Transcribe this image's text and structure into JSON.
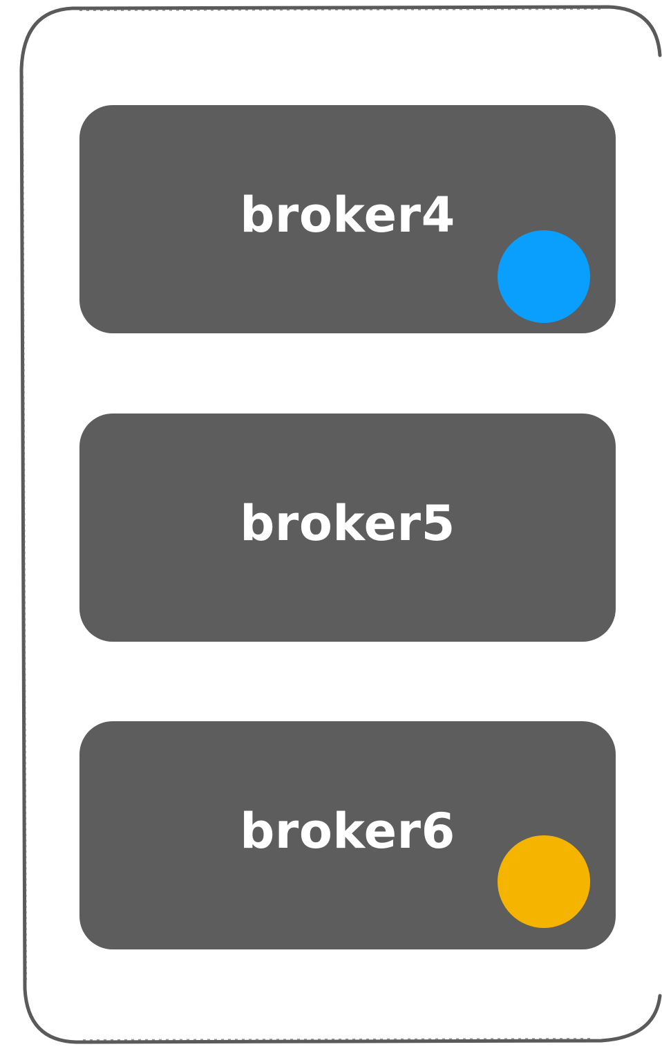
{
  "brokers": [
    {
      "label": "broker4",
      "marker": {
        "present": true,
        "color": "#0a9ffc"
      }
    },
    {
      "label": "broker5",
      "marker": {
        "present": false,
        "color": ""
      }
    },
    {
      "label": "broker6",
      "marker": {
        "present": true,
        "color": "#f5b400"
      }
    }
  ],
  "colors": {
    "broker_fill": "#5d5d5d",
    "frame_stroke": "#5a5a5a",
    "label": "#ffffff"
  }
}
